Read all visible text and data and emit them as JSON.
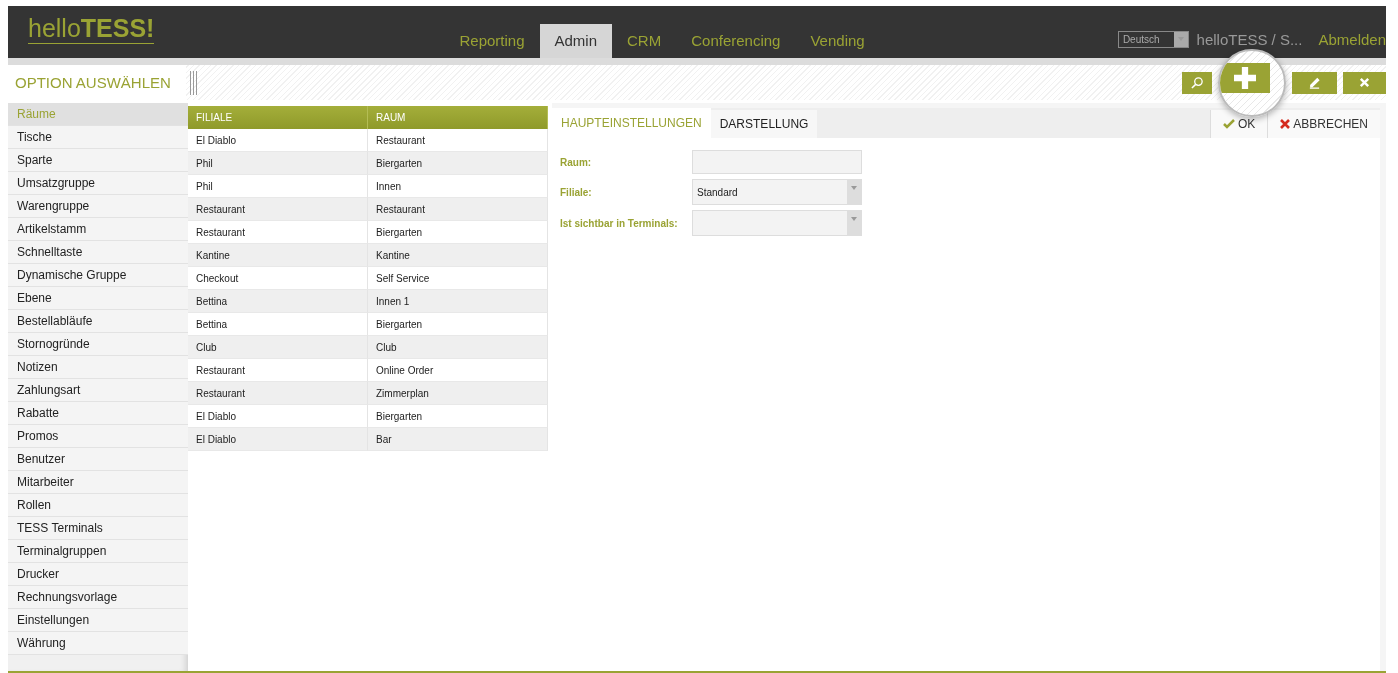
{
  "header": {
    "logo": "hello**TESS!**",
    "nav": [
      {
        "label": "Reporting",
        "selected": false
      },
      {
        "label": "Admin",
        "selected": true
      },
      {
        "label": "CRM",
        "selected": false
      },
      {
        "label": "Conferencing",
        "selected": false
      },
      {
        "label": "Vending",
        "selected": false
      }
    ],
    "language": "Deutsch",
    "user": "helloTESS / S...",
    "logout": "Abmelden"
  },
  "toolbar": {
    "buttons": [
      {
        "kind": "search",
        "magnified": false
      },
      {
        "kind": "add",
        "magnified": true
      },
      {
        "kind": "edit",
        "magnified": false
      },
      {
        "kind": "delete",
        "magnified": false
      }
    ]
  },
  "sidebar": {
    "title": "OPTION AUSWÄHLEN",
    "items": [
      {
        "label": "Räume",
        "selected": true
      },
      {
        "label": "Tische",
        "selected": false
      },
      {
        "label": "Sparte",
        "selected": false
      },
      {
        "label": "Umsatzgruppe",
        "selected": false
      },
      {
        "label": "Warengruppe",
        "selected": false
      },
      {
        "label": "Artikelstamm",
        "selected": false
      },
      {
        "label": "Schnelltaste",
        "selected": false
      },
      {
        "label": "Dynamische Gruppe",
        "selected": false
      },
      {
        "label": "Ebene",
        "selected": false
      },
      {
        "label": "Bestellabläufe",
        "selected": false
      },
      {
        "label": "Stornogründe",
        "selected": false
      },
      {
        "label": "Notizen",
        "selected": false
      },
      {
        "label": "Zahlungsart",
        "selected": false
      },
      {
        "label": "Rabatte",
        "selected": false
      },
      {
        "label": "Promos",
        "selected": false
      },
      {
        "label": "Benutzer",
        "selected": false
      },
      {
        "label": "Mitarbeiter",
        "selected": false
      },
      {
        "label": "Rollen",
        "selected": false
      },
      {
        "label": "TESS Terminals",
        "selected": false
      },
      {
        "label": "Terminalgruppen",
        "selected": false
      },
      {
        "label": "Drucker",
        "selected": false
      },
      {
        "label": "Rechnungsvorlage",
        "selected": false
      },
      {
        "label": "Einstellungen",
        "selected": false
      },
      {
        "label": "Währung",
        "selected": false
      }
    ]
  },
  "table": {
    "columns": [
      "FILIALE",
      "RAUM"
    ],
    "rows": [
      [
        "El Diablo",
        "Restaurant"
      ],
      [
        "Phil",
        "Biergarten"
      ],
      [
        "Phil",
        "Innen"
      ],
      [
        "Restaurant",
        "Restaurant"
      ],
      [
        "Restaurant",
        "Biergarten"
      ],
      [
        "Kantine",
        "Kantine"
      ],
      [
        "Checkout",
        "Self Service"
      ],
      [
        "Bettina",
        "Innen 1"
      ],
      [
        "Bettina",
        "Biergarten"
      ],
      [
        "Club",
        "Club"
      ],
      [
        "Restaurant",
        "Online Order"
      ],
      [
        "Restaurant",
        "Zimmerplan"
      ],
      [
        "El Diablo",
        "Biergarten"
      ],
      [
        "El Diablo",
        "Bar"
      ]
    ]
  },
  "form": {
    "tabs": [
      {
        "label": "HAUPTEINSTELLUNGEN",
        "selected": true
      },
      {
        "label": "DARSTELLUNG",
        "selected": false
      }
    ],
    "actions": [
      {
        "kind": "ok",
        "label": "OK"
      },
      {
        "kind": "cancel",
        "label": "ABBRECHEN"
      }
    ],
    "fields": [
      {
        "label": "Raum:",
        "kind": "text"
      },
      {
        "label": "Filiale:",
        "kind": "select",
        "value": "Standard"
      },
      {
        "label": "Ist sichtbar in Terminals:",
        "kind": "select"
      }
    ]
  }
}
